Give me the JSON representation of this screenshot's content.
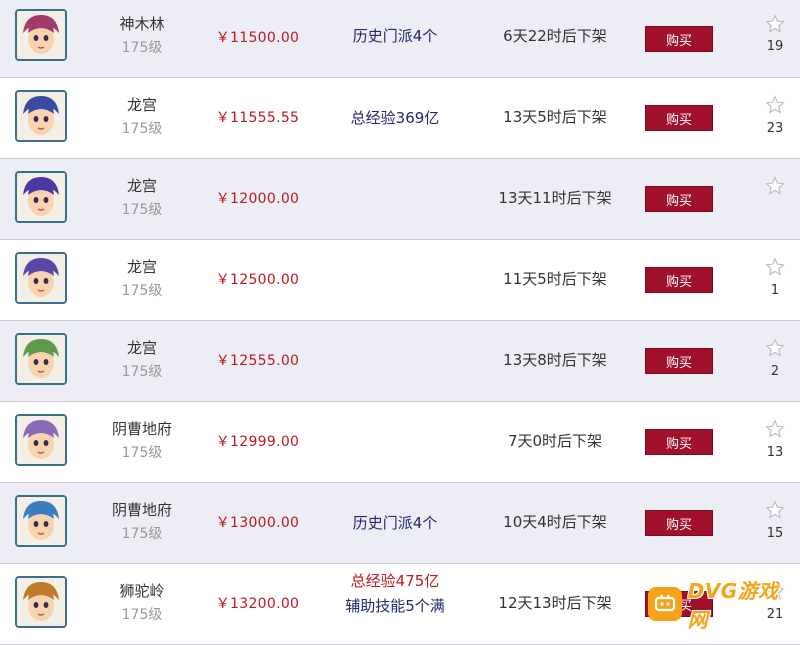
{
  "colors": {
    "price": "#c0181f",
    "button_bg": "#a1112c",
    "row_alt_bg": "#ecedf5",
    "description": "#1f2a6e",
    "watermark": "#f5a31a"
  },
  "listings": [
    {
      "school": "神木林",
      "level": "175级",
      "price": "￥11500.00",
      "desc_lines": [
        "历史门派4个"
      ],
      "time": "6天22时后下架",
      "buy": "购买",
      "favorites": "19",
      "avatar_color": "#a23a6b"
    },
    {
      "school": "龙宫",
      "level": "175级",
      "price": "￥11555.55",
      "desc_lines": [
        "总经验369亿"
      ],
      "time": "13天5时后下架",
      "buy": "购买",
      "favorites": "23",
      "avatar_color": "#3a4aa0"
    },
    {
      "school": "龙宫",
      "level": "175级",
      "price": "￥12000.00",
      "desc_lines": [],
      "time": "13天11时后下架",
      "buy": "购买",
      "favorites": "",
      "avatar_color": "#4a3aa0"
    },
    {
      "school": "龙宫",
      "level": "175级",
      "price": "￥12500.00",
      "desc_lines": [],
      "time": "11天5时后下架",
      "buy": "购买",
      "favorites": "1",
      "avatar_color": "#5a48a8"
    },
    {
      "school": "龙宫",
      "level": "175级",
      "price": "￥12555.00",
      "desc_lines": [],
      "time": "13天8时后下架",
      "buy": "购买",
      "favorites": "2",
      "avatar_color": "#5e9a4a"
    },
    {
      "school": "阴曹地府",
      "level": "175级",
      "price": "￥12999.00",
      "desc_lines": [],
      "time": "7天0时后下架",
      "buy": "购买",
      "favorites": "13",
      "avatar_color": "#8a6ab8"
    },
    {
      "school": "阴曹地府",
      "level": "175级",
      "price": "￥13000.00",
      "desc_lines": [
        "历史门派4个"
      ],
      "time": "10天4时后下架",
      "buy": "购买",
      "favorites": "15",
      "avatar_color": "#3a7ec0"
    },
    {
      "school": "狮驼岭",
      "level": "175级",
      "price": "￥13200.00",
      "desc_lines": [
        "总经验475亿",
        "辅助技能5个满"
      ],
      "time": "12天13时后下架",
      "buy": "购买",
      "favorites": "21",
      "avatar_color": "#c07a2a"
    }
  ],
  "watermark": {
    "text": "DVG游戏网",
    "icon": "game-controller-icon"
  }
}
